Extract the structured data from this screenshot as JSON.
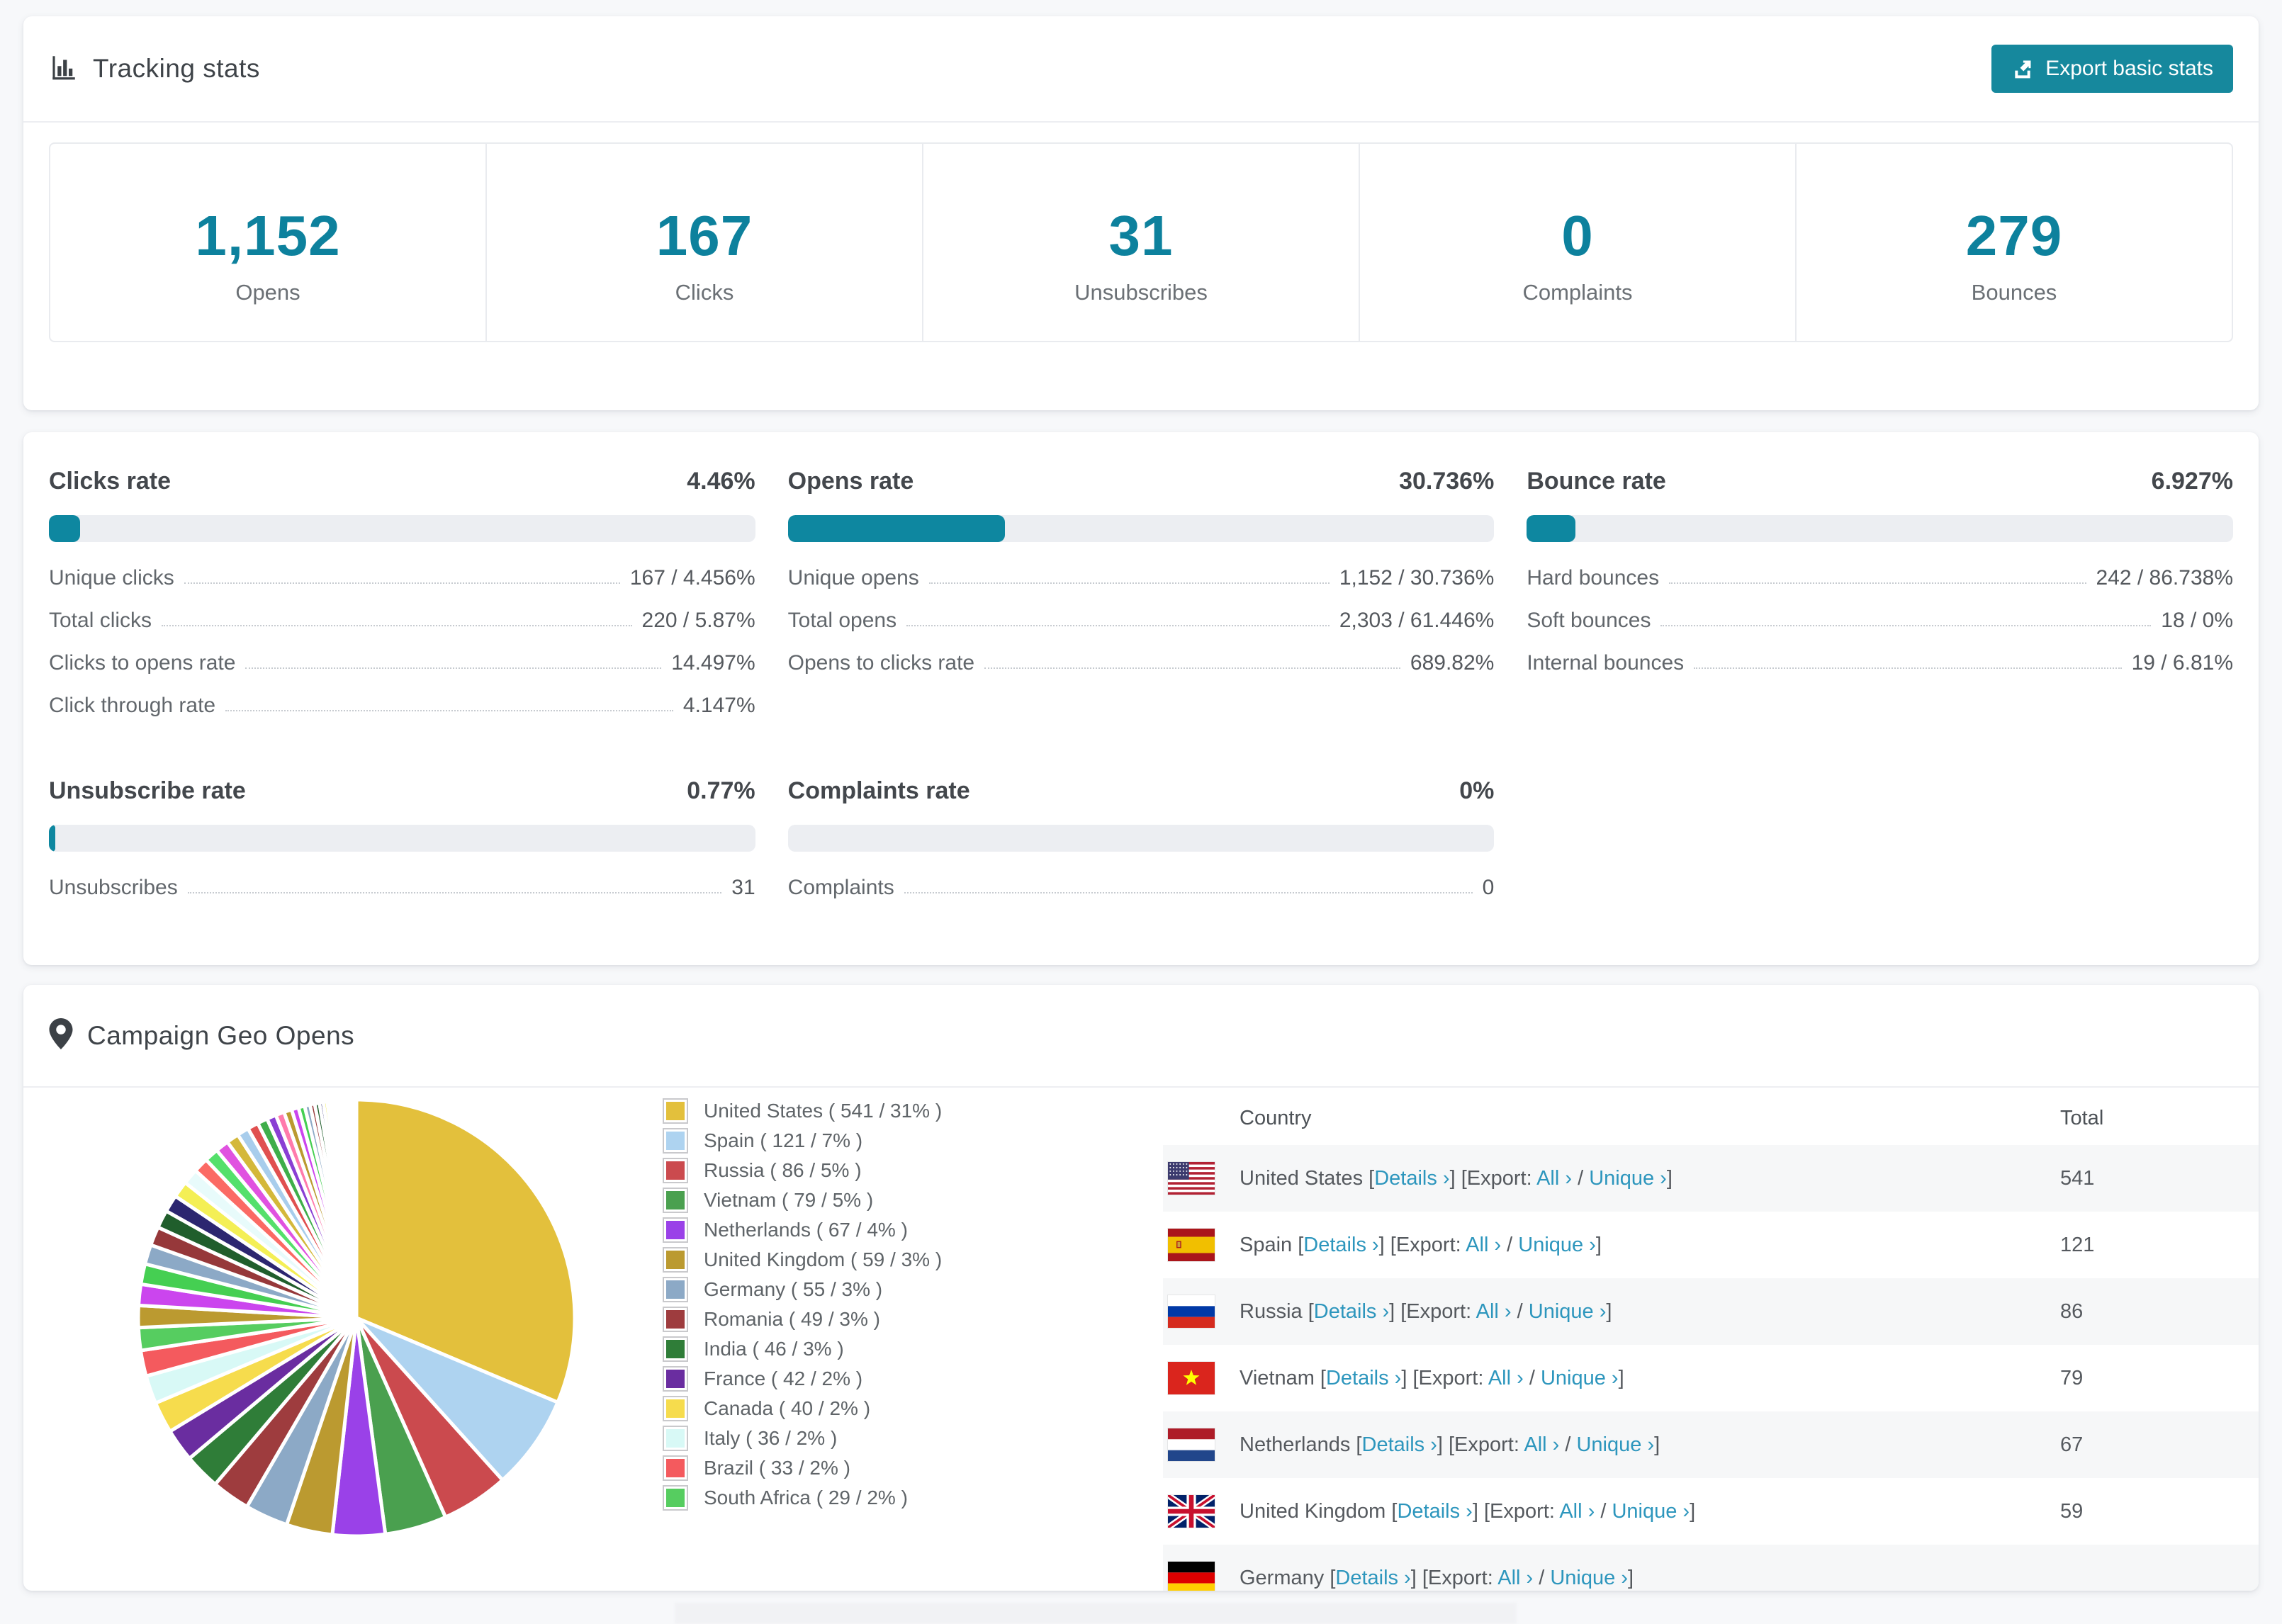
{
  "colors": {
    "accent_button": "#16889d",
    "accent_number": "#0d819d",
    "accent_bar": "#0e87a0",
    "link": "#2d96bd",
    "bar_track": "#eceef2"
  },
  "tracking": {
    "title": "Tracking stats",
    "export_button": "Export basic stats",
    "stats": [
      {
        "value": "1,152",
        "label": "Opens"
      },
      {
        "value": "167",
        "label": "Clicks"
      },
      {
        "value": "31",
        "label": "Unsubscribes"
      },
      {
        "value": "0",
        "label": "Complaints"
      },
      {
        "value": "279",
        "label": "Bounces"
      }
    ]
  },
  "rates": [
    {
      "title": "Clicks rate",
      "value": "4.46%",
      "percent": 4.46,
      "rows": [
        {
          "label": "Unique clicks",
          "value": "167 / 4.456%"
        },
        {
          "label": "Total clicks",
          "value": "220 / 5.87%"
        },
        {
          "label": "Clicks to opens rate",
          "value": "14.497%"
        },
        {
          "label": "Click through rate",
          "value": "4.147%"
        }
      ]
    },
    {
      "title": "Opens rate",
      "value": "30.736%",
      "percent": 30.736,
      "rows": [
        {
          "label": "Unique opens",
          "value": "1,152 / 30.736%"
        },
        {
          "label": "Total opens",
          "value": "2,303 / 61.446%"
        },
        {
          "label": "Opens to clicks rate",
          "value": "689.82%"
        }
      ]
    },
    {
      "title": "Bounce rate",
      "value": "6.927%",
      "percent": 6.927,
      "rows": [
        {
          "label": "Hard bounces",
          "value": "242 / 86.738%"
        },
        {
          "label": "Soft bounces",
          "value": "18 / 0%"
        },
        {
          "label": "Internal bounces",
          "value": "19 / 6.81%"
        }
      ]
    },
    {
      "title": "Unsubscribe rate",
      "value": "0.77%",
      "percent": 0.77,
      "rows": [
        {
          "label": "Unsubscribes",
          "value": "31"
        }
      ]
    },
    {
      "title": "Complaints rate",
      "value": "0%",
      "percent": 0,
      "rows": [
        {
          "label": "Complaints",
          "value": "0"
        }
      ]
    }
  ],
  "geo": {
    "title": "Campaign Geo Opens",
    "table": {
      "headers": [
        "Country",
        "Total"
      ],
      "links": {
        "details_label": "Details ›",
        "export_label": "Export:",
        "all_label": "All ›",
        "unique_label": "Unique ›",
        "bracket_open": "[",
        "bracket_close": "]",
        "slash": "/"
      },
      "rows": [
        {
          "country": "United States",
          "flag": "us",
          "total": "541"
        },
        {
          "country": "Spain",
          "flag": "es",
          "total": "121"
        },
        {
          "country": "Russia",
          "flag": "ru",
          "total": "86"
        },
        {
          "country": "Vietnam",
          "flag": "vn",
          "total": "79"
        },
        {
          "country": "Netherlands",
          "flag": "nl",
          "total": "67"
        },
        {
          "country": "United Kingdom",
          "flag": "gb",
          "total": "59"
        },
        {
          "country": "Germany",
          "flag": "de",
          "total": ""
        }
      ]
    }
  },
  "chart_data": {
    "type": "pie",
    "title": "Campaign Geo Opens",
    "legend_position": "right",
    "series": [
      {
        "name": "United States",
        "value": 541,
        "pct": 31,
        "color": "#e3c03c",
        "label": "United States ( 541 / 31% )"
      },
      {
        "name": "Spain",
        "value": 121,
        "pct": 7,
        "color": "#aed3f0",
        "label": "Spain ( 121 / 7% )"
      },
      {
        "name": "Russia",
        "value": 86,
        "pct": 5,
        "color": "#cb4a4e",
        "label": "Russia ( 86 / 5% )"
      },
      {
        "name": "Vietnam",
        "value": 79,
        "pct": 5,
        "color": "#4aa04f",
        "label": "Vietnam ( 79 / 5% )"
      },
      {
        "name": "Netherlands",
        "value": 67,
        "pct": 4,
        "color": "#9a41e8",
        "label": "Netherlands ( 67 / 4% )"
      },
      {
        "name": "United Kingdom",
        "value": 59,
        "pct": 3,
        "color": "#bb9a30",
        "label": "United Kingdom ( 59 / 3% )"
      },
      {
        "name": "Germany",
        "value": 55,
        "pct": 3,
        "color": "#8ca9c6",
        "label": "Germany ( 55 / 3% )"
      },
      {
        "name": "Romania",
        "value": 49,
        "pct": 3,
        "color": "#9e3c3e",
        "label": "Romania ( 49 / 3% )"
      },
      {
        "name": "India",
        "value": 46,
        "pct": 3,
        "color": "#2f7d38",
        "label": "India ( 46 / 3% )"
      },
      {
        "name": "France",
        "value": 42,
        "pct": 2,
        "color": "#6a2da0",
        "label": "France ( 42 / 2% )"
      },
      {
        "name": "Canada",
        "value": 40,
        "pct": 2,
        "color": "#f6dc4d",
        "label": "Canada ( 40 / 2% )"
      },
      {
        "name": "Italy",
        "value": 36,
        "pct": 2,
        "color": "#d8f9f6",
        "label": "Italy ( 36 / 2% )"
      },
      {
        "name": "Brazil",
        "value": 33,
        "pct": 2,
        "color": "#f45a5e",
        "label": "Brazil ( 33 / 2% )"
      },
      {
        "name": "South Africa",
        "value": 29,
        "pct": 2,
        "color": "#56cd60",
        "label": "South Africa ( 29 / 2% )"
      }
    ],
    "others_estimated_values": [
      28,
      27,
      26,
      25,
      24,
      23,
      22,
      21,
      20,
      19,
      18,
      17,
      16,
      15,
      14,
      13,
      12,
      11,
      10,
      9,
      8,
      7,
      6,
      6,
      5,
      5,
      4,
      4,
      3,
      3,
      3,
      2,
      2,
      2,
      2,
      1,
      1,
      1,
      1,
      1,
      1,
      1,
      1,
      1,
      1,
      1,
      1
    ],
    "others_palette": [
      "#bb9a30",
      "#cb45ee",
      "#45cf52",
      "#8ca9c6",
      "#96383a",
      "#205e2c",
      "#2c2670",
      "#f4ef55",
      "#e8fbfb",
      "#fb6a64",
      "#54e06b",
      "#e052e0",
      "#d4b83a",
      "#a8cdec",
      "#e05050",
      "#3fae4a",
      "#8a3fd4",
      "#ff7bac"
    ]
  }
}
